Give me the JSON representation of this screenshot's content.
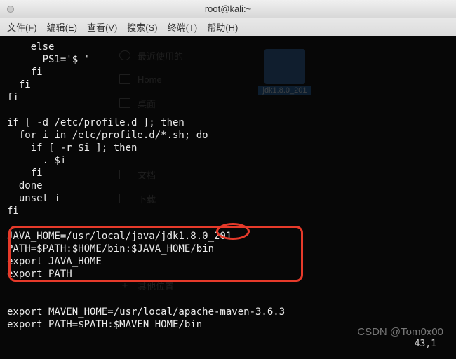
{
  "window": {
    "title": "root@kali:~"
  },
  "menu": {
    "file": "文件(F)",
    "edit": "编辑(E)",
    "view": "查看(V)",
    "search": "搜索(S)",
    "terminal": "终端(T)",
    "help": "帮助(H)"
  },
  "ghost_sidebar": {
    "recent": "最近使用的",
    "home": "Home",
    "desktop": "桌面",
    "documents": "文档",
    "downloads": "下载",
    "other": "其他位置"
  },
  "ghost_folder": {
    "label": "jdk1.8.0_201"
  },
  "code": {
    "l1": "    else",
    "l2": "      PS1='$ '",
    "l3": "    fi",
    "l4": "  fi",
    "l5": "fi",
    "l6": "",
    "l7": "if [ -d /etc/profile.d ]; then",
    "l8": "  for i in /etc/profile.d/*.sh; do",
    "l9": "    if [ -r $i ]; then",
    "l10": "      . $i",
    "l11": "    fi",
    "l12": "  done",
    "l13": "  unset i",
    "l14": "fi",
    "l15": "",
    "l16": "JAVA_HOME=/usr/local/java/jdk1.8.0_201",
    "l17": "PATH=$PATH:$HOME/bin:$JAVA_HOME/bin",
    "l18": "export JAVA_HOME",
    "l19": "export PATH",
    "l20": "",
    "l21": "",
    "l22": "export MAVEN_HOME=/usr/local/apache-maven-3.6.3",
    "l23": "export PATH=$PATH:$MAVEN_HOME/bin"
  },
  "status": {
    "position": "43,1"
  },
  "watermark": "CSDN @Tom0x00"
}
